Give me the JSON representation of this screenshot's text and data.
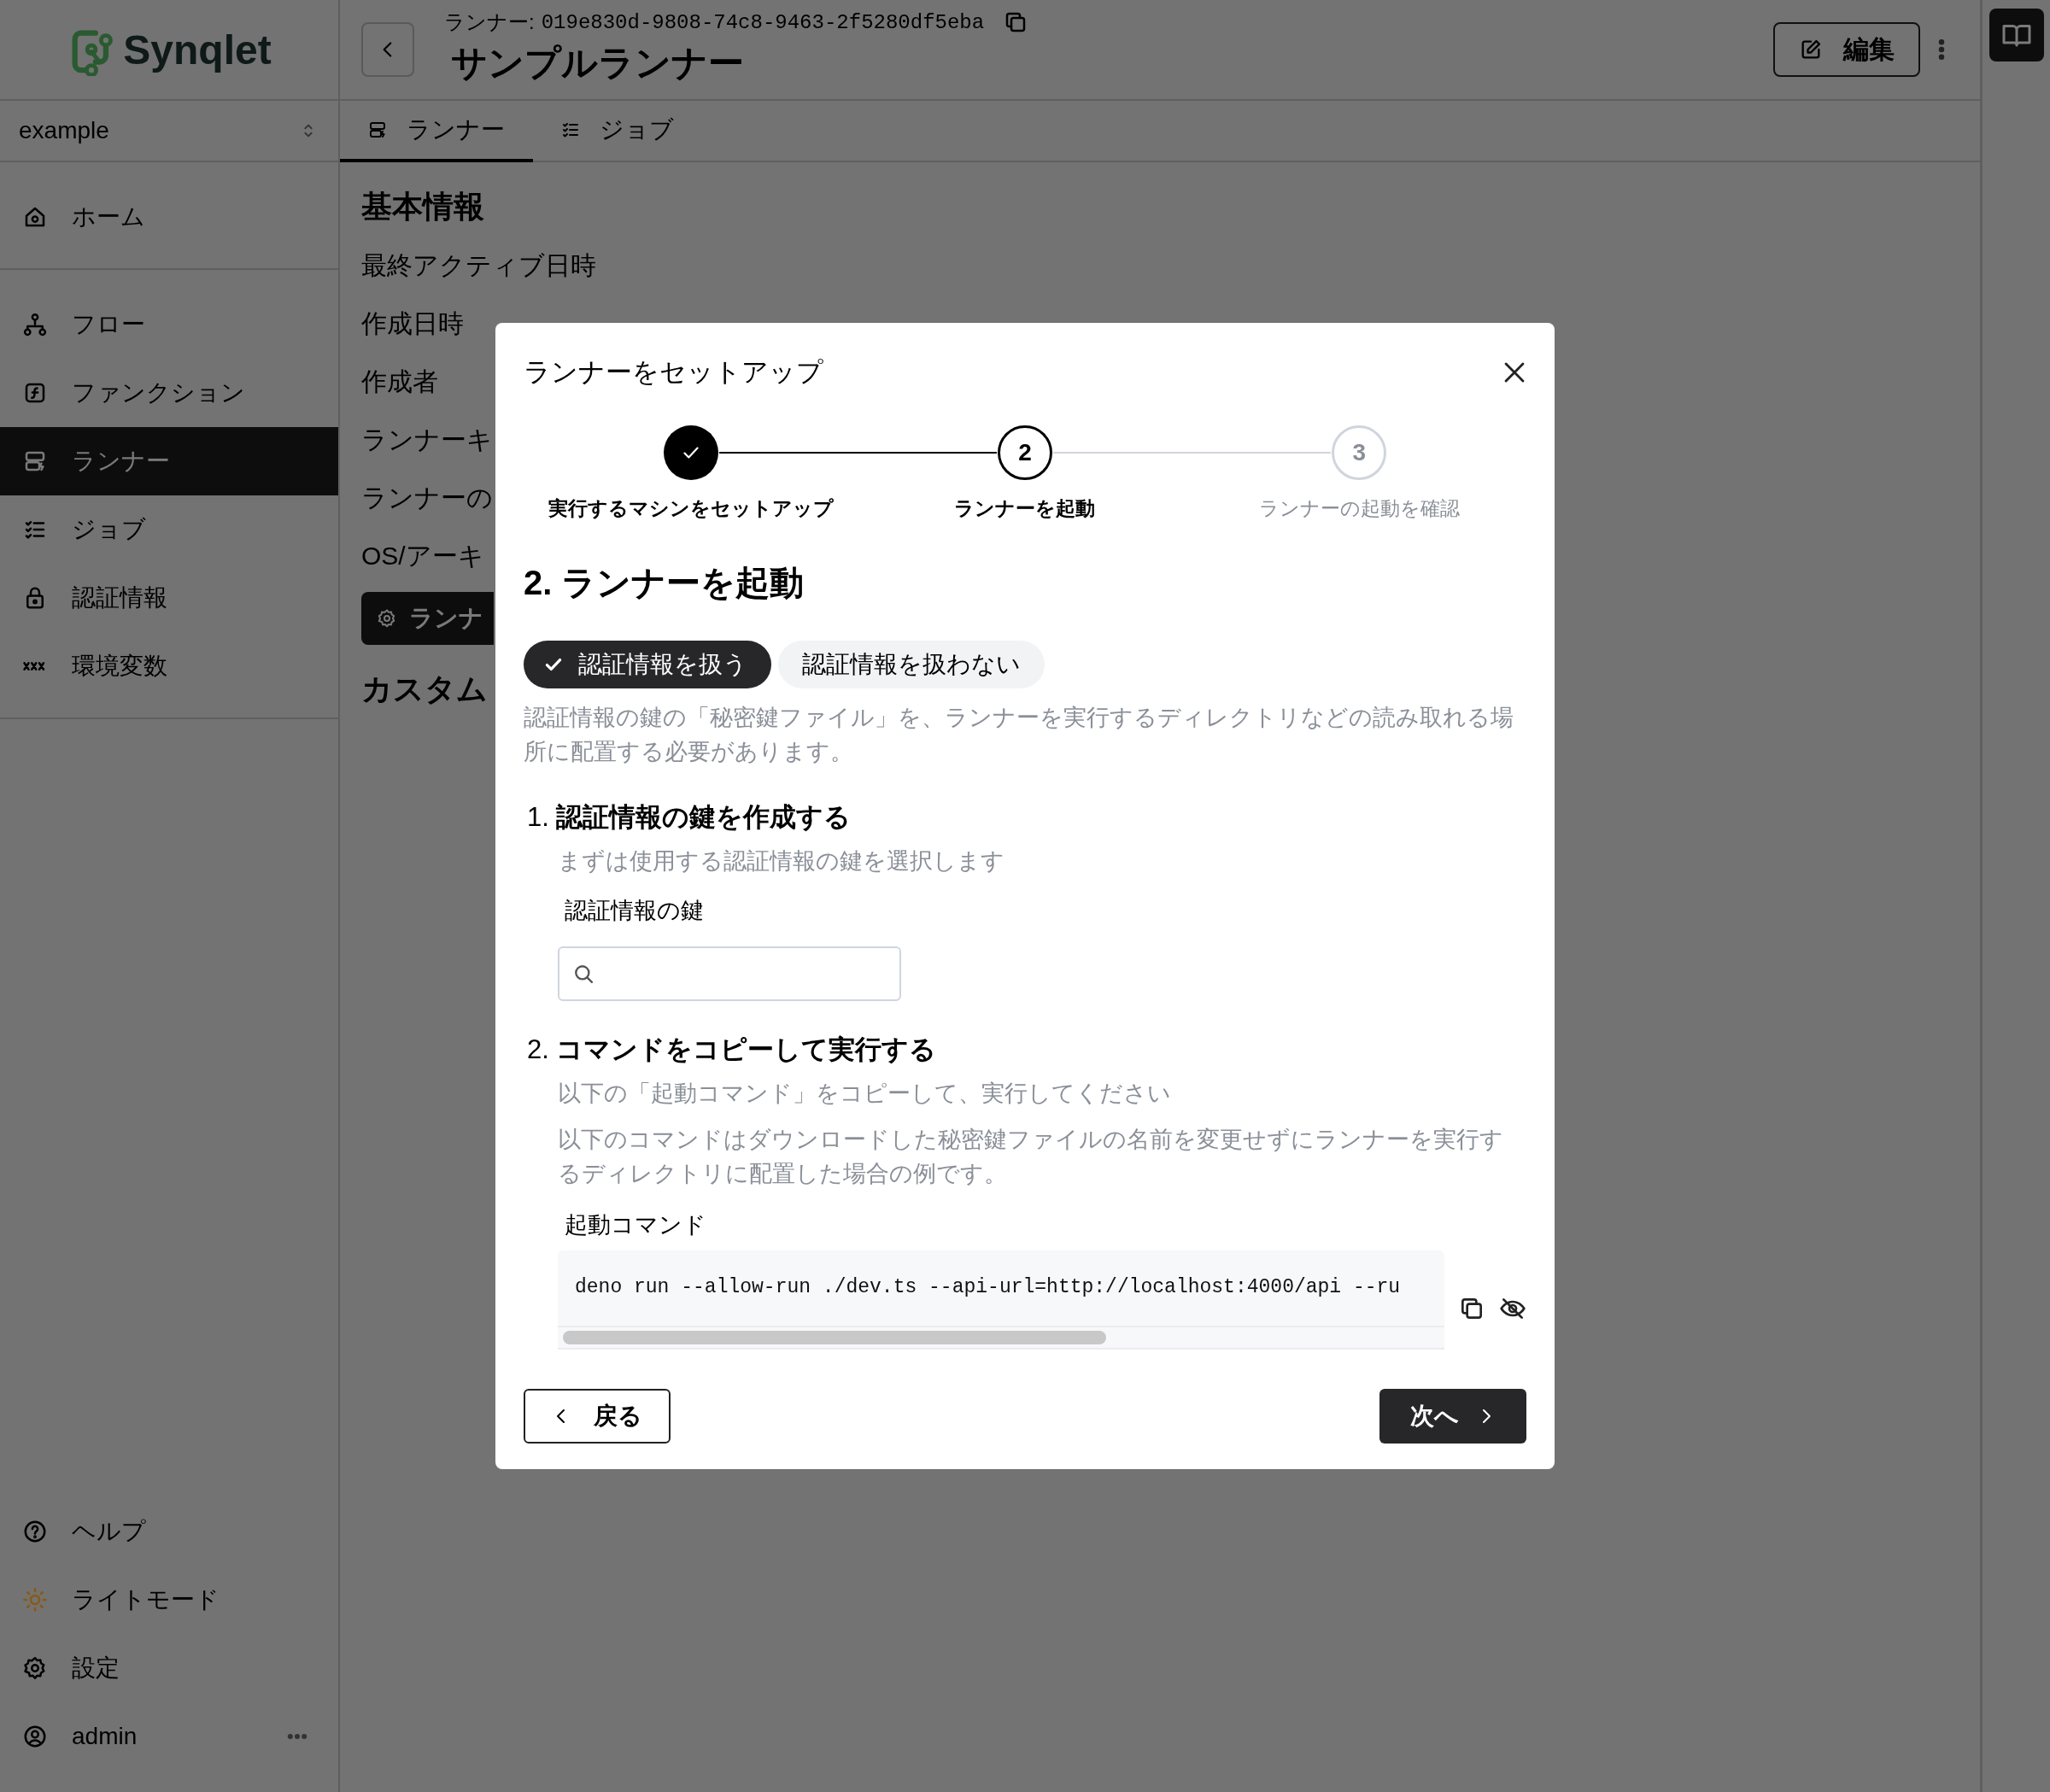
{
  "sidebar": {
    "logo": "Synqlet",
    "workspace": "example",
    "nav": [
      [
        {
          "label": "ホーム",
          "selected": false
        }
      ],
      [
        {
          "label": "フロー",
          "selected": false
        },
        {
          "label": "ファンクション",
          "selected": false
        },
        {
          "label": "ランナー",
          "selected": true
        },
        {
          "label": "ジョブ",
          "selected": false
        },
        {
          "label": "認証情報",
          "selected": false
        },
        {
          "label": "環境変数",
          "selected": false
        }
      ]
    ],
    "footer": [
      {
        "label": "ヘルプ"
      },
      {
        "label": "ライトモード"
      },
      {
        "label": "設定"
      },
      {
        "label": "admin"
      }
    ]
  },
  "header": {
    "id_prefix": "ランナー:",
    "id": "019e830d-9808-74c8-9463-2f5280df5eba",
    "title": "サンプルランナー",
    "edit_button": "編集"
  },
  "tabs": [
    {
      "label": "ランナー",
      "selected": true
    },
    {
      "label": "ジョブ",
      "selected": false
    }
  ],
  "details": {
    "heading": "基本情報",
    "rows": [
      "最終アクティブ日時",
      "作成日時",
      "作成者",
      "ランナーキ",
      "ランナーの",
      "OS/アーキ"
    ],
    "action_button": "ランナ",
    "section_heading": "カスタム"
  },
  "modal": {
    "title": "ランナーをセットアップ",
    "steps": [
      {
        "label": "実行するマシンをセットアップ",
        "completed": true,
        "current": false
      },
      {
        "number": "2",
        "label": "ランナーを起動",
        "completed": false,
        "current": true
      },
      {
        "number": "3",
        "label": "ランナーの起動を確認",
        "completed": false,
        "current": false
      }
    ],
    "heading": "2. ランナーを起動",
    "modes": [
      {
        "label": "認証情報を扱う",
        "selected": true
      },
      {
        "label": "認証情報を扱わない",
        "selected": false
      }
    ],
    "description": "認証情報の鍵の「秘密鍵ファイル」を、ランナーを実行するディレクトリなどの読み取れる場所に配置する必要があります。",
    "key_section": {
      "number": "1.",
      "title": "認証情報の鍵を作成する",
      "hint": "まずは使用する認証情報の鍵を選択します",
      "field_label": "認証情報の鍵"
    },
    "command_section": {
      "number": "2.",
      "title": "コマンドをコピーして実行する",
      "hint": "以下の「起動コマンド」をコピーして、実行してください",
      "note": "以下のコマンドはダウンロードした秘密鍵ファイルの名前を変更せずにランナーを実行するディレクトリに配置した場合の例です。",
      "command_label": "起動コマンド",
      "command": "deno run --allow-run ./dev.ts --api-url=http://localhost:4000/api --ru"
    },
    "back_button": "戻る",
    "next_button": "次へ"
  }
}
